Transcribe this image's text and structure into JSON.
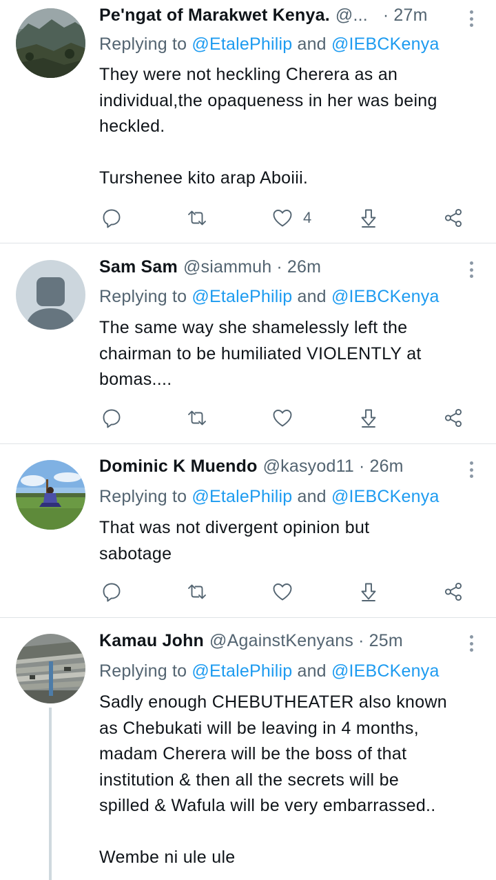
{
  "tweets": [
    {
      "name": "Pe'ngat of Marakwet Kenya.",
      "handle": "@...",
      "sep": "·",
      "time": "27m",
      "reply_prefix": "Replying to ",
      "mention1": "@EtalePhilip",
      "reply_and": " and ",
      "mention2": "@IEBCKenya",
      "body": [
        "They were not heckling Cherera as an",
        "individual,the opaqueness in her was being",
        "heckled."
      ],
      "body2": "Turshenee kito arap Aboiii.",
      "like_count": "4",
      "avatar_icon": "landscape-photo-avatar"
    },
    {
      "name": "Sam Sam",
      "handle": "@siammuh",
      "sep": "·",
      "time": "26m",
      "reply_prefix": "Replying to ",
      "mention1": "@EtalePhilip",
      "reply_and": " and ",
      "mention2": "@IEBCKenya",
      "body": [
        "The same way she shamelessly left the",
        "chairman to be humiliated VIOLENTLY at",
        "bomas...."
      ],
      "like_count": "",
      "avatar_icon": "default-person-avatar"
    },
    {
      "name": "Dominic K Muendo",
      "handle": "@kasyod11",
      "sep": "·",
      "time": "26m",
      "reply_prefix": "Replying to ",
      "mention1": "@EtalePhilip",
      "reply_and": " and ",
      "mention2": "@IEBCKenya",
      "body": [
        "That was not divergent opinion but",
        "sabotage"
      ],
      "like_count": "",
      "avatar_icon": "person-on-field-photo-avatar"
    },
    {
      "name": "Kamau John",
      "handle": "@AgainstKenyans",
      "sep": "·",
      "time": "25m",
      "reply_prefix": "Replying to ",
      "mention1": "@EtalePhilip",
      "reply_and": " and ",
      "mention2": "@IEBCKenya",
      "body": [
        "Sadly enough CHEBUTHEATER also known",
        "as Chebukati will be leaving in 4 months,",
        "madam Cherera will be the boss of that",
        "institution & then all the secrets will be",
        "spilled & Wafula will be very embarrassed.."
      ],
      "body2": "Wembe ni ule ule",
      "avatar_icon": "collapsed-building-photo-avatar"
    }
  ],
  "icons": {
    "reply": "reply-icon",
    "retweet": "retweet-icon",
    "like": "like-icon",
    "download": "download-icon",
    "share": "share-icon",
    "more": "more-vertical-icon"
  },
  "colors": {
    "mention": "#1d9bf0",
    "secondary_text": "#536471",
    "primary_text": "#0f1419",
    "divider": "#dfe3e6"
  }
}
